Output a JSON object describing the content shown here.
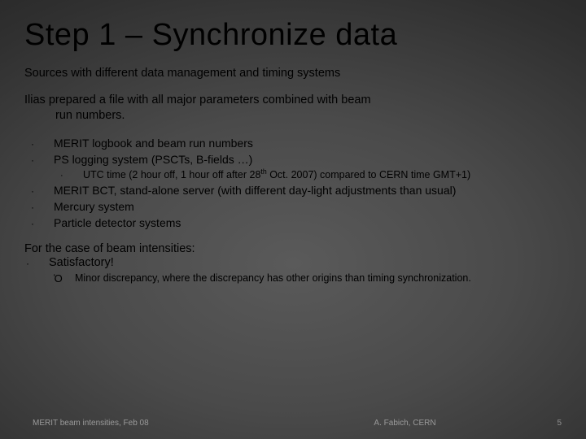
{
  "title": "Step 1 – Synchronize data",
  "para1": "Sources with different data management and timing systems",
  "para2_a": "Ilias prepared a file with all major parameters combined with beam",
  "para2_b": "run numbers.",
  "bullets": [
    "MERIT logbook and beam run numbers",
    "PS logging system (PSCTs, B-fields …)"
  ],
  "subbullet_pre": "UTC time (2 hour off, 1 hour off after 28",
  "subbullet_sup": "th",
  "subbullet_post": " Oct. 2007) compared to CERN time GMT+1)",
  "bullets2": [
    "MERIT BCT, stand-alone server (with different day-light adjustments than usual)",
    "Mercury system",
    "Particle detector systems"
  ],
  "para3": "For the case of beam intensities:",
  "satisfactory": "Satisfactory!",
  "arrow_text": "Minor discrepancy, where the discrepancy has other origins than timing synchronization.",
  "footer": {
    "left": "MERIT beam intensities, Feb 08",
    "center": "A. Fabich, CERN",
    "right": "5"
  }
}
